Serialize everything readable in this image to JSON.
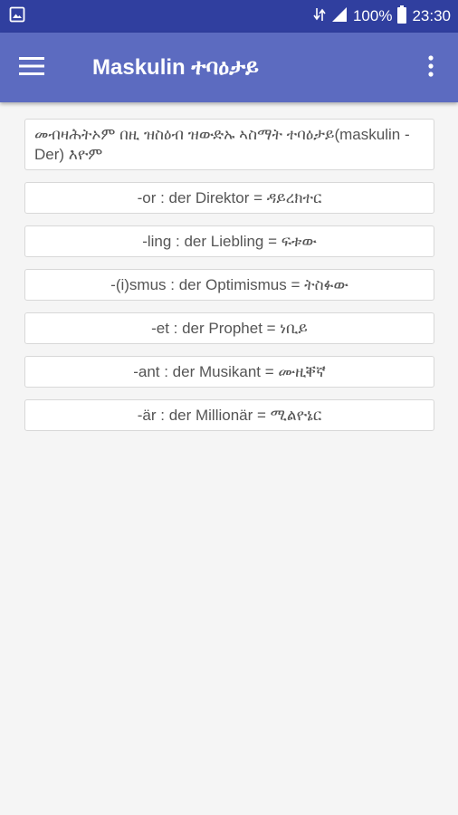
{
  "status_bar": {
    "battery_percent": "100%",
    "time": "23:30",
    "icons": [
      "gallery-icon",
      "data-arrows-icon",
      "signal-icon",
      "battery-icon"
    ]
  },
  "app_bar": {
    "title": "Maskulin ተባዕታይ",
    "icons": [
      "menu-icon",
      "more-vert-icon"
    ]
  },
  "intro_text": "መብዛሕትኦም በዚ ዝስዕብ ዝውድኡ ኣስማት ተባዕታይ(maskulin - Der) እዮም",
  "items": [
    "-or : der Direktor = ዳይረክተር",
    "-ling : der Liebling = ፍቱው",
    "-(i)smus : der Optimismus = ትስፉው",
    "-et : der Prophet = ነቢይ",
    "-ant : der Musikant = ሙዚቐኛ",
    "-är : der Millionär = ሚልዮኔር"
  ],
  "colors": {
    "status_bar": "#303f9f",
    "app_bar": "#5c6bc0",
    "background": "#f5f5f5",
    "text": "#555555"
  }
}
